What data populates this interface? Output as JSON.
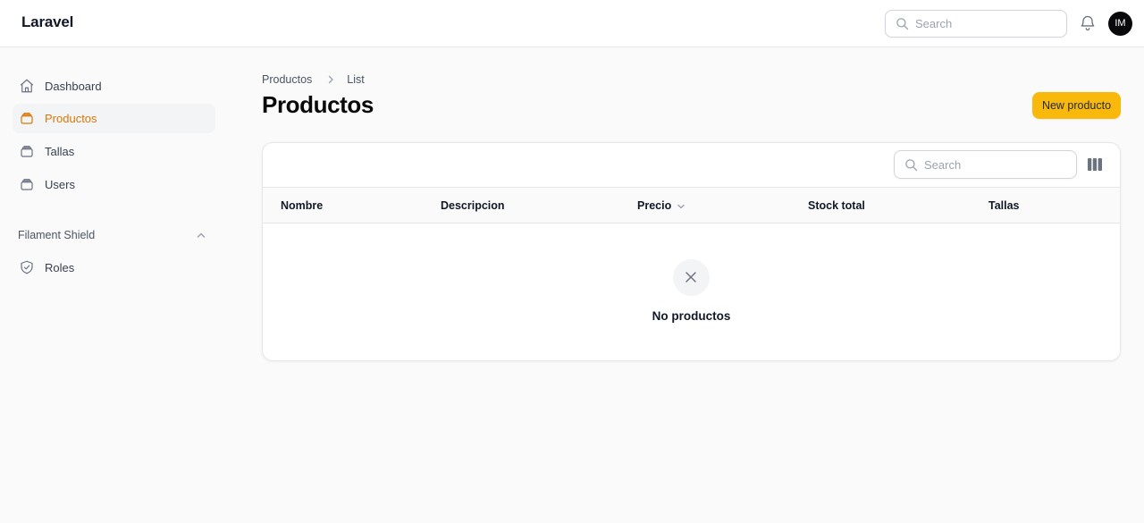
{
  "header": {
    "brand": "Laravel",
    "search_placeholder": "Search",
    "avatar_initials": "IM"
  },
  "sidebar": {
    "items": [
      {
        "label": "Dashboard",
        "icon": "home-icon",
        "active": false
      },
      {
        "label": "Productos",
        "icon": "rectangle-stack-icon",
        "active": true
      },
      {
        "label": "Tallas",
        "icon": "rectangle-stack-icon",
        "active": false
      },
      {
        "label": "Users",
        "icon": "rectangle-stack-icon",
        "active": false
      }
    ],
    "group": {
      "label": "Filament Shield",
      "items": [
        {
          "label": "Roles",
          "icon": "shield-check-icon",
          "active": false
        }
      ]
    }
  },
  "breadcrumb": [
    "Productos",
    "List"
  ],
  "page": {
    "title": "Productos",
    "new_button_label": "New producto"
  },
  "table": {
    "search_placeholder": "Search",
    "columns": [
      {
        "label": "Nombre",
        "sortable": false
      },
      {
        "label": "Descripcion",
        "sortable": false
      },
      {
        "label": "Precio",
        "sortable": true
      },
      {
        "label": "Stock total",
        "sortable": false
      },
      {
        "label": "Tallas",
        "sortable": false
      }
    ],
    "rows": [],
    "empty_state": "No productos"
  },
  "colors": {
    "accent": "#d97706",
    "button_bg": "#f9b80c",
    "avatar_bg": "#09090b"
  }
}
